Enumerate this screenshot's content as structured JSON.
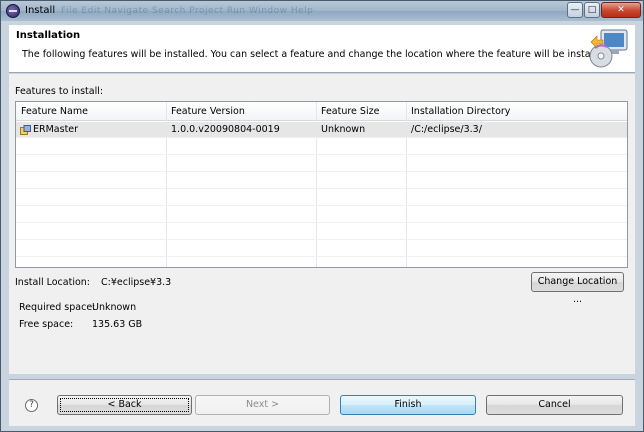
{
  "window": {
    "title": "Install",
    "background_menu_ghost": "File   Edit   Navigate   Search   Project   Run   Window   Help",
    "controls": {
      "minimize": "—",
      "maximize": "□",
      "close": "✕"
    }
  },
  "banner": {
    "heading": "Installation",
    "description": "The following features will be installed. You can select a feature and change the location where the feature will be installed."
  },
  "features": {
    "label": "Features to install:",
    "columns": [
      "Feature Name",
      "Feature Version",
      "Feature Size",
      "Installation Directory"
    ],
    "rows": [
      {
        "name": "ERMaster",
        "version": "1.0.0.v20090804-0019",
        "size": "Unknown",
        "directory": "/C:/eclipse/3.3/",
        "selected": true,
        "icon": "feature-plugin-icon"
      }
    ],
    "empty_rows": 8
  },
  "install_location": {
    "label": "Install Location:",
    "value": "C:¥eclipse¥3.3"
  },
  "change_location_button": "Change Location ...",
  "space": {
    "required_label": "Required space:",
    "required_value": "Unknown",
    "free_label": "Free space:",
    "free_value": "135.63 GB"
  },
  "footer": {
    "help_icon": "help-icon",
    "back_label": "< Back",
    "next_label": "Next >",
    "finish_label": "Finish",
    "cancel_label": "Cancel"
  },
  "colors": {
    "selection": "#e6e6e6",
    "default_button": "#bee6fd",
    "window_frame": "#c9d4df"
  }
}
